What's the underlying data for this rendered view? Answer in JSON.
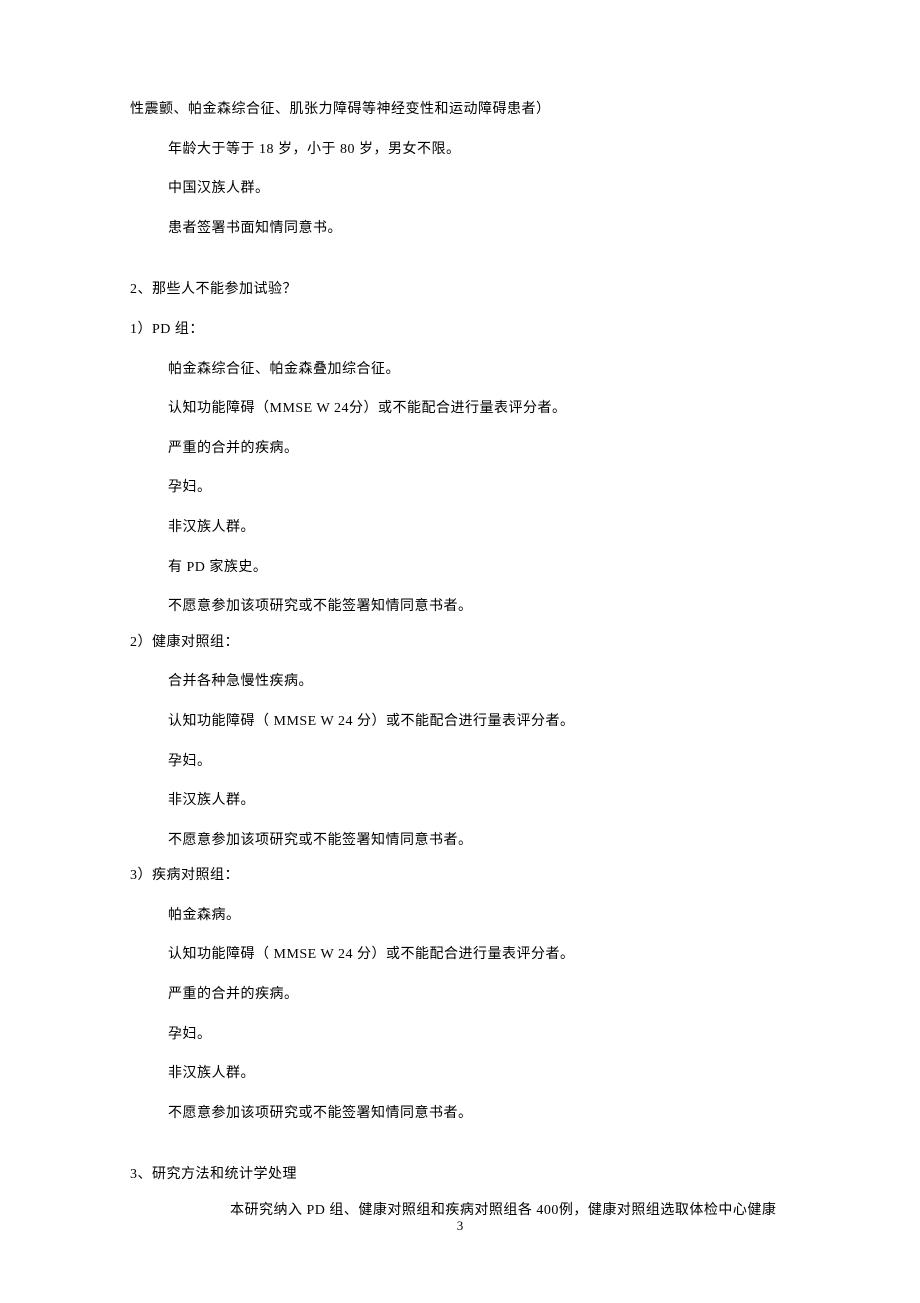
{
  "lines": {
    "l1": "性震颤、帕金森综合征、肌张力障碍等神经变性和运动障碍患者）",
    "l2": "年龄大于等于 18 岁，小于 80 岁，男女不限。",
    "l3": "中国汉族人群。",
    "l4": "患者签署书面知情同意书。",
    "q2": "2、那些人不能参加试验？",
    "g1": "1）PD 组：",
    "g1a": "帕金森综合征、帕金森叠加综合征。",
    "g1b": "认知功能障碍（MMSE W 24分）或不能配合进行量表评分者。",
    "g1c": "严重的合并的疾病。",
    "g1d": "孕妇。",
    "g1e": "非汉族人群。",
    "g1f": "有 PD 家族史。",
    "g1g": "不愿意参加该项研究或不能签署知情同意书者。",
    "g2": "2）健康对照组：",
    "g2a": "合并各种急慢性疾病。",
    "g2b": "认知功能障碍（ MMSE W 24 分）或不能配合进行量表评分者。",
    "g2c": "孕妇。",
    "g2d": "非汉族人群。",
    "g2e": "不愿意参加该项研究或不能签署知情同意书者。",
    "g3": "3）疾病对照组：",
    "g3a": "帕金森病。",
    "g3b": "认知功能障碍（ MMSE W 24 分）或不能配合进行量表评分者。",
    "g3c": "严重的合并的疾病。",
    "g3d": "孕妇。",
    "g3e": "非汉族人群。",
    "g3f": "不愿意参加该项研究或不能签署知情同意书者。",
    "q3": "3、研究方法和统计学处理",
    "foot": "本研究纳入 PD 组、健康对照组和疾病对照组各 400例，健康对照组选取体检中心健康"
  },
  "pageNumber": "3"
}
